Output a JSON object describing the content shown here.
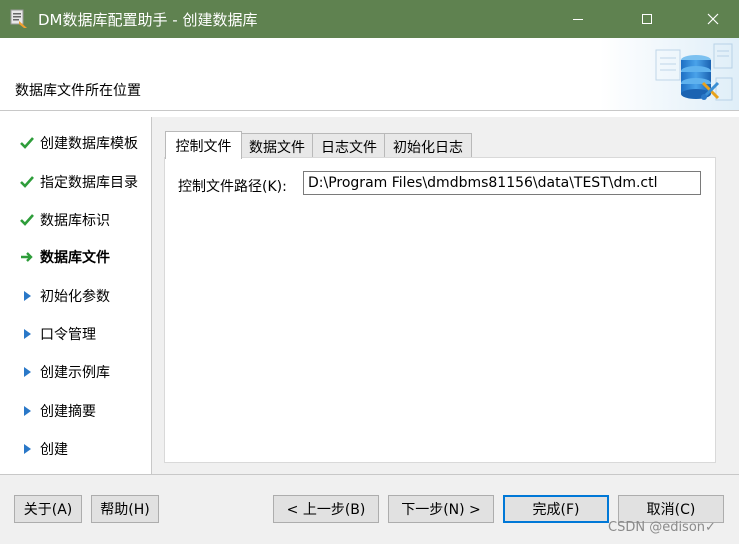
{
  "window": {
    "title": "DM数据库配置助手 - 创建数据库",
    "controls": [
      "minimize-icon",
      "maximize-icon",
      "close-icon"
    ]
  },
  "header": {
    "label": "数据库文件所在位置",
    "art_icon": "database-tools-icon"
  },
  "steps": [
    {
      "label": "创建数据库模板",
      "state": "done",
      "icon": "check-icon"
    },
    {
      "label": "指定数据库目录",
      "state": "done",
      "icon": "check-icon"
    },
    {
      "label": "数据库标识",
      "state": "done",
      "icon": "check-icon"
    },
    {
      "label": "数据库文件",
      "state": "current",
      "icon": "arrow-right-icon"
    },
    {
      "label": "初始化参数",
      "state": "pending",
      "icon": "triangle-right-icon"
    },
    {
      "label": "口令管理",
      "state": "pending",
      "icon": "triangle-right-icon"
    },
    {
      "label": "创建示例库",
      "state": "pending",
      "icon": "triangle-right-icon"
    },
    {
      "label": "创建摘要",
      "state": "pending",
      "icon": "triangle-right-icon"
    },
    {
      "label": "创建",
      "state": "pending",
      "icon": "triangle-right-icon"
    }
  ],
  "tabs": [
    {
      "label": "控制文件",
      "selected": true
    },
    {
      "label": "数据文件",
      "selected": false
    },
    {
      "label": "日志文件",
      "selected": false
    },
    {
      "label": "初始化日志",
      "selected": false
    }
  ],
  "control_file": {
    "path_label": "控制文件路径(K):",
    "path_value": "D:\\Program Files\\dmdbms81156\\data\\TEST\\dm.ctl"
  },
  "buttons": {
    "about": "关于(A)",
    "help": "帮助(H)",
    "back": "< 上一步(B)",
    "next": "下一步(N) >",
    "finish": "完成(F)",
    "cancel": "取消(C)"
  },
  "watermark": "CSDN @edison✓",
  "colors": {
    "titlebar": "#5f8250",
    "check": "#2e9d3a",
    "triangle": "#2a78c8",
    "default_button_border": "#0078d7"
  }
}
